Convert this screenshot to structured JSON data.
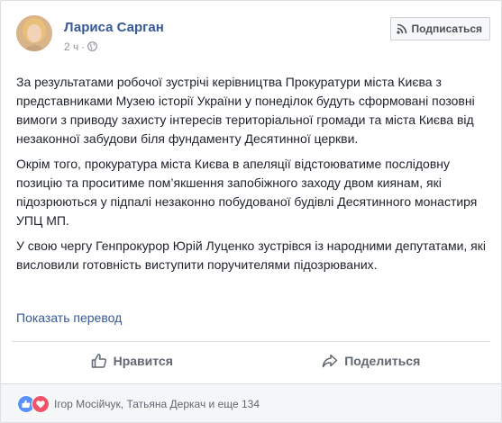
{
  "post": {
    "author": {
      "name": "Лариса Сарган",
      "avatar_icon": "profile-photo"
    },
    "timestamp": "2 ч",
    "privacy_icon": "globe-icon",
    "follow_button": {
      "label": "Подписаться",
      "icon": "rss-icon"
    },
    "paragraphs": [
      "За результатами робочої зустрічі керівництва Прокуратури міста Києва з представниками Музею історії України у понеділок будуть сформовані позовні вимоги з приводу захисту інтересів територіальної громади та міста Києва від незаконної забудови біля фундаменту Десятинної церкви.",
      "Окрім того, прокуратура міста Києва в апеляції відстоюватиме послідовну позицію та проситиме пом’якшення запобіжного заходу двом киянам, які підозрюються у підпалі незаконно побудованої будівлі Десятинного монастиря УПЦ МП.",
      "У свою чергу Генпрокурор Юрій Луценко зустрівся із народними депутатами, які висловили готовність виступити поручителями підозрюваних."
    ],
    "translate_link": "Показать перевод"
  },
  "actions": {
    "like_label": "Нравится",
    "share_label": "Поделиться"
  },
  "reactions": {
    "icons": [
      "like-reaction-icon",
      "love-reaction-icon"
    ],
    "summary": "Ігор Мосійчук, Татьяна Деркач и еще 134"
  },
  "colors": {
    "link": "#365899",
    "text": "#1d2129",
    "meta": "#90949c",
    "like_blue": "#5890ff",
    "love_red": "#f25268"
  }
}
